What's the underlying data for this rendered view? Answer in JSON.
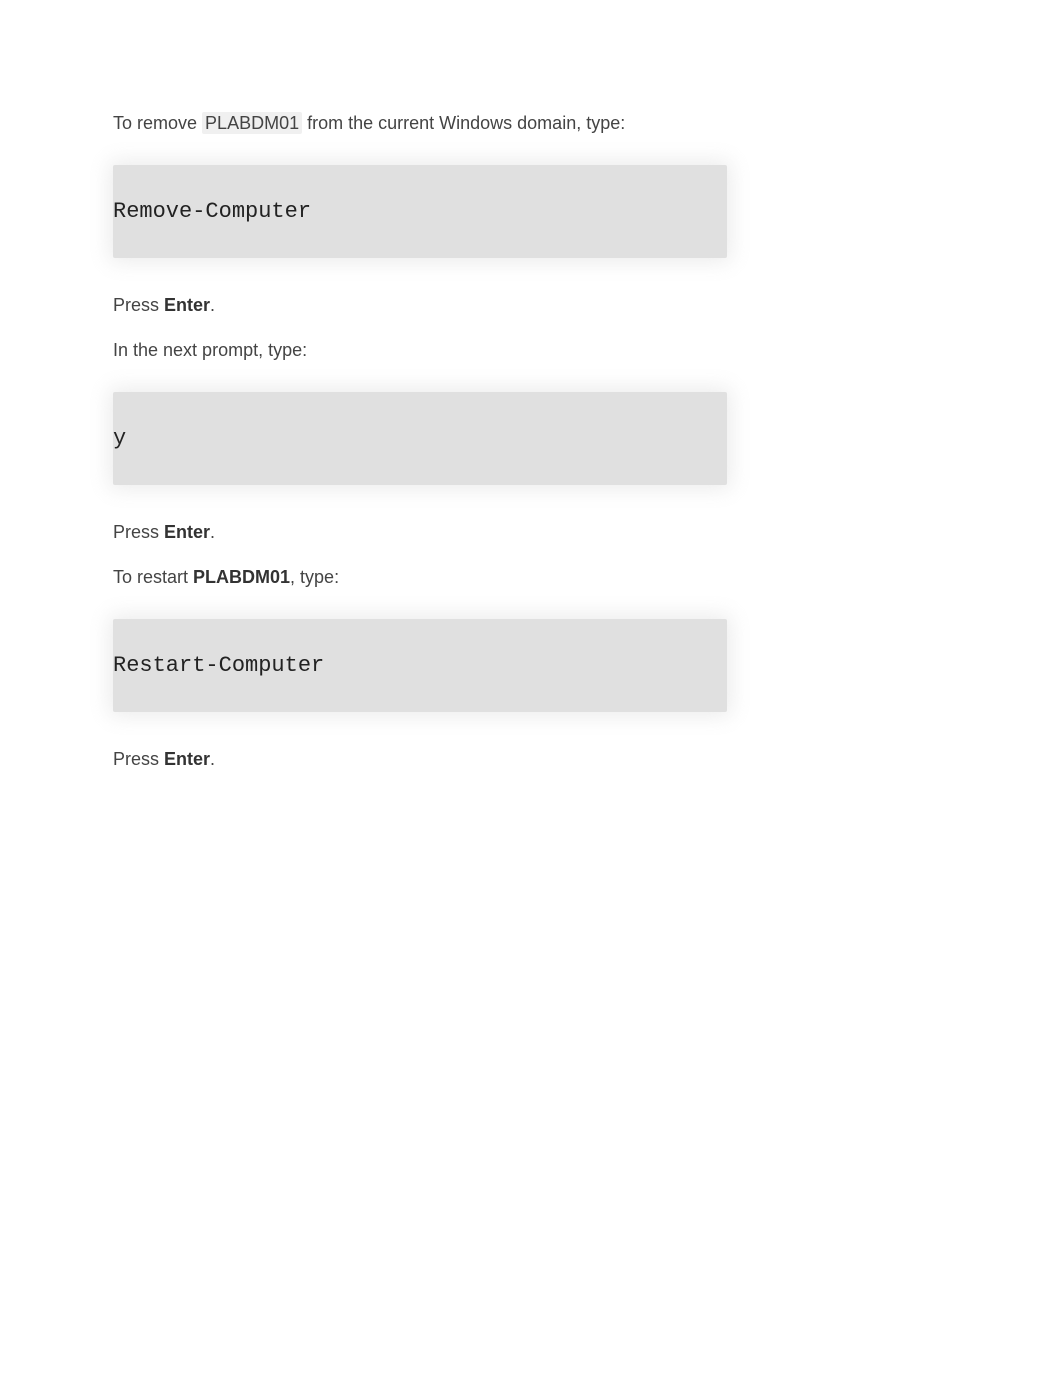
{
  "para1": {
    "prefix": "To remove ",
    "highlight": "PLABDM01",
    "suffix": " from the current Windows domain, type:"
  },
  "code1": "Remove-Computer",
  "para2": {
    "prefix": "Press ",
    "bold": "Enter",
    "suffix": "."
  },
  "para3": "In the next prompt, type:",
  "code2": "y",
  "para4": {
    "prefix": "Press ",
    "bold": "Enter",
    "suffix": "."
  },
  "para5": {
    "prefix": "To restart ",
    "bold": "PLABDM01",
    "suffix": ", type:"
  },
  "code3": "Restart-Computer",
  "para6": {
    "prefix": "Press ",
    "bold": "Enter",
    "suffix": "."
  }
}
